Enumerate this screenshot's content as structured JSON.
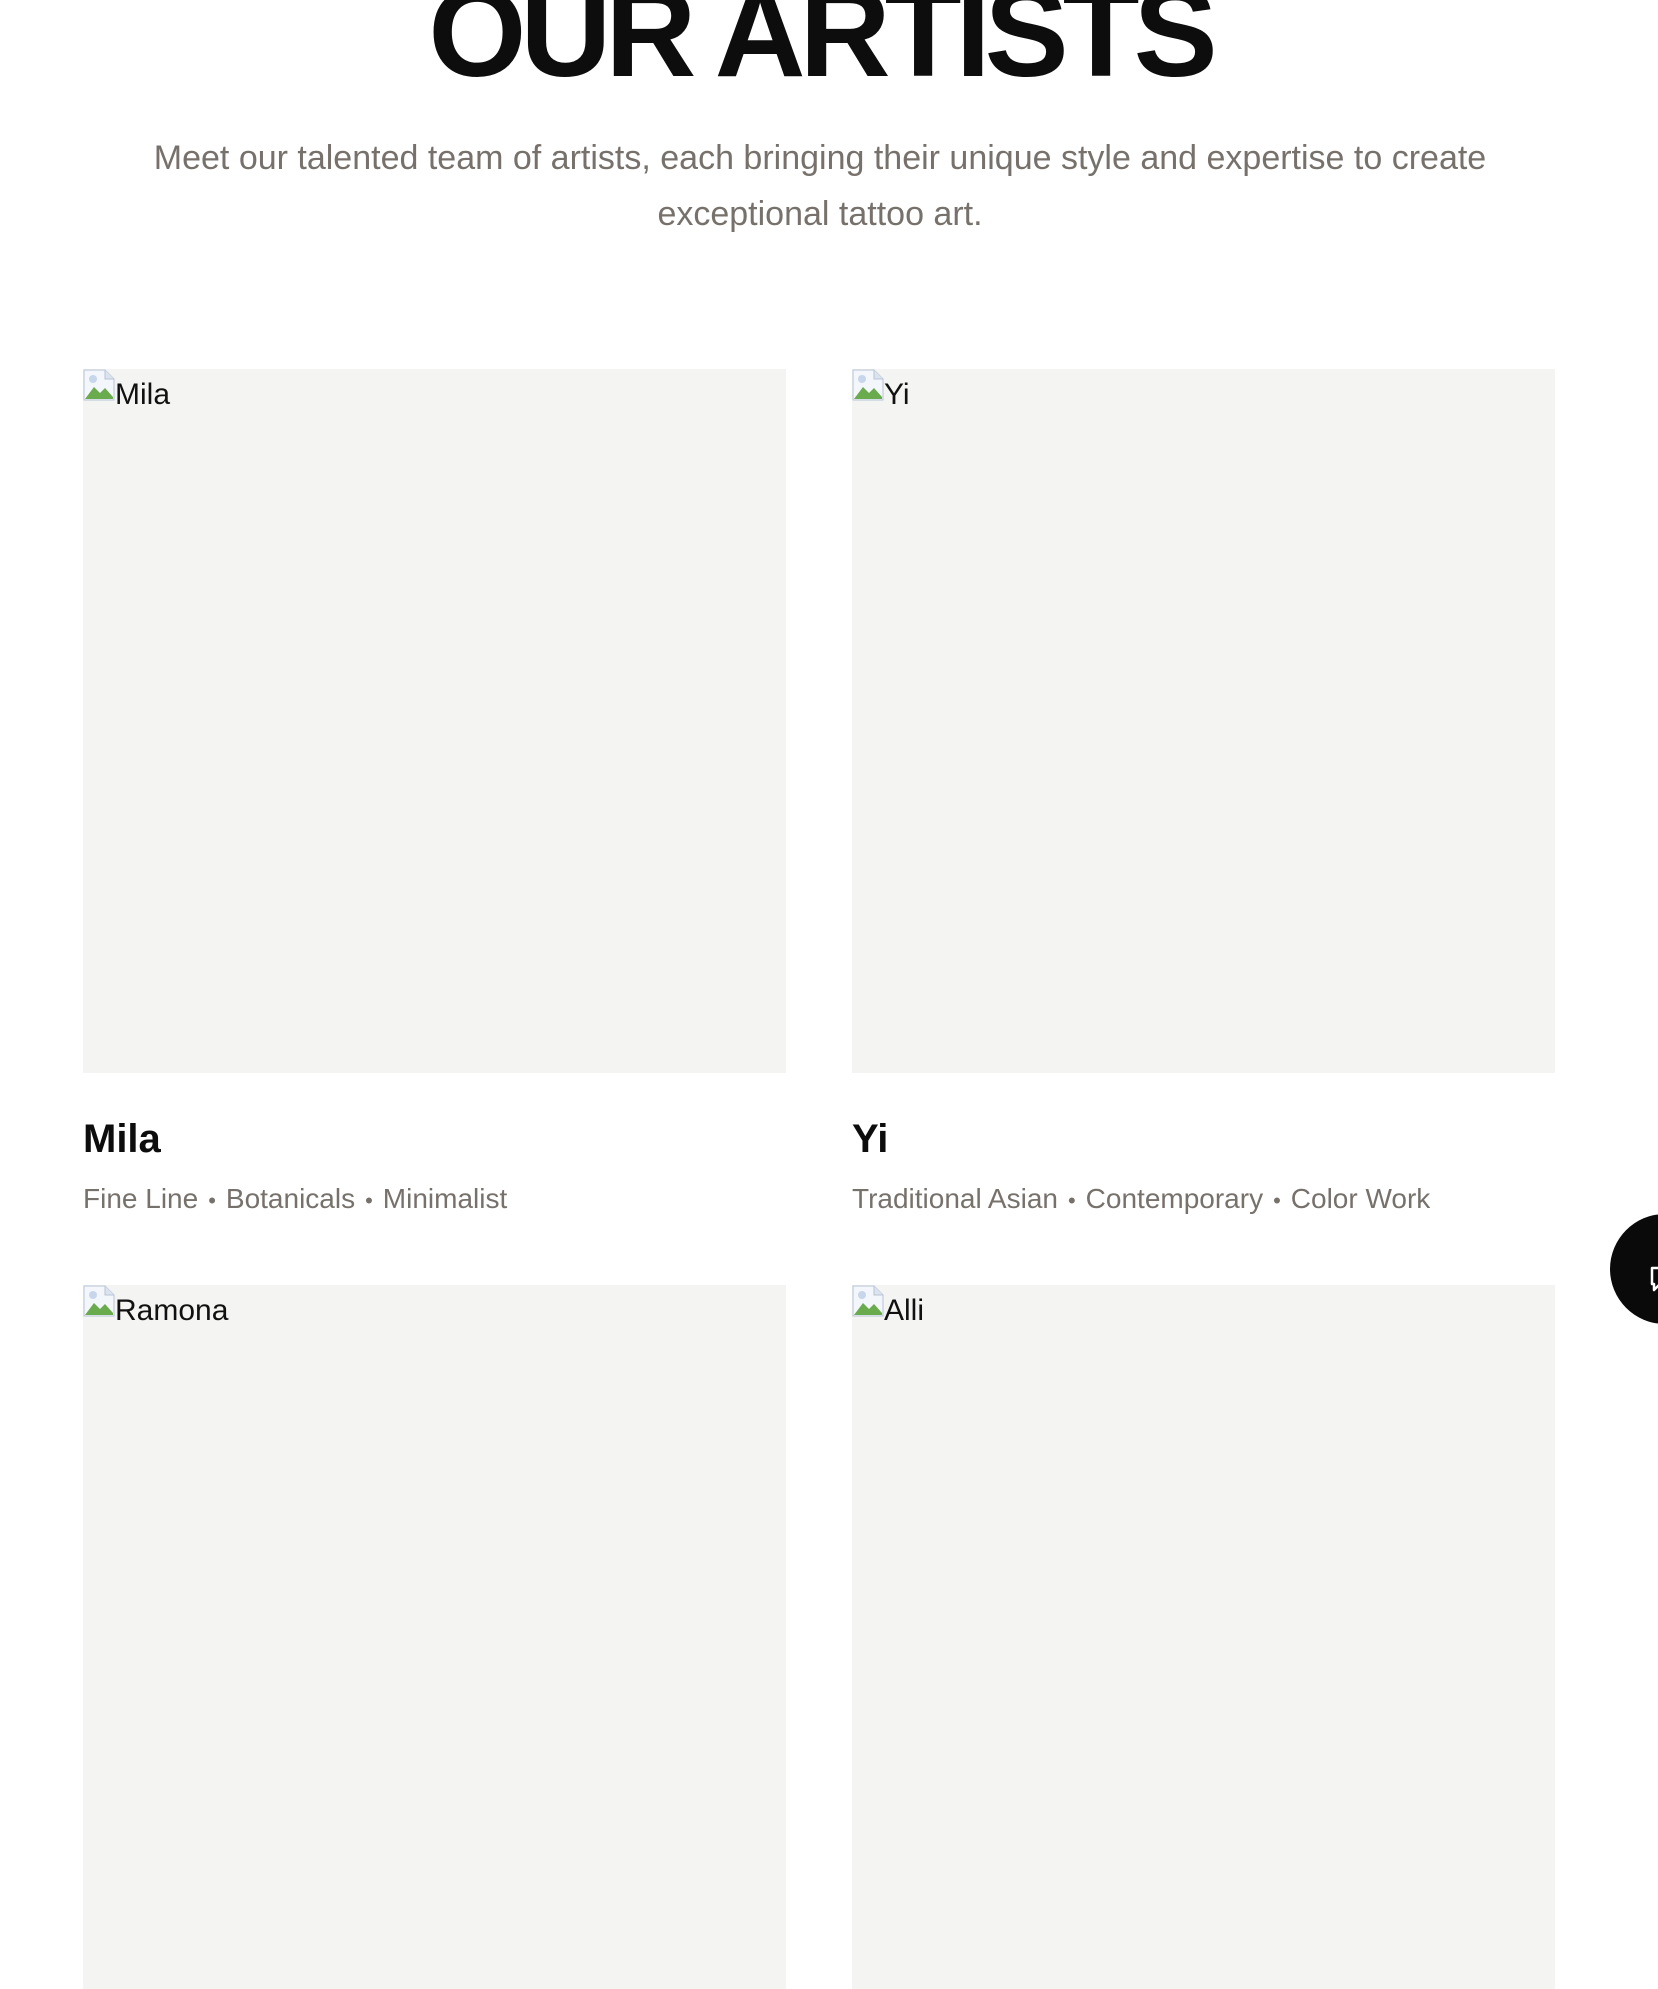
{
  "header": {
    "title": "OUR ARTISTS",
    "intro": "Meet our talented team of artists, each bringing their unique style and expertise to create exceptional tattoo art."
  },
  "artists": [
    {
      "name": "Mila",
      "image_alt": "Mila",
      "tags": [
        "Fine Line",
        "Botanicals",
        "Minimalist"
      ]
    },
    {
      "name": "Yi",
      "image_alt": "Yi",
      "tags": [
        "Traditional Asian",
        "Contemporary",
        "Color Work"
      ]
    },
    {
      "name": "",
      "image_alt": "Ramona",
      "tags": []
    },
    {
      "name": "",
      "image_alt": "Alli",
      "tags": []
    }
  ],
  "tag_separator": "•",
  "icons": {
    "broken_image": "broken-image-icon",
    "chat": "chat-icon"
  },
  "colors": {
    "heading": "#0d0d0d",
    "muted_text": "#77716c",
    "image_placeholder": "#f4f4f2",
    "chat_button": "#0a0a0a"
  }
}
